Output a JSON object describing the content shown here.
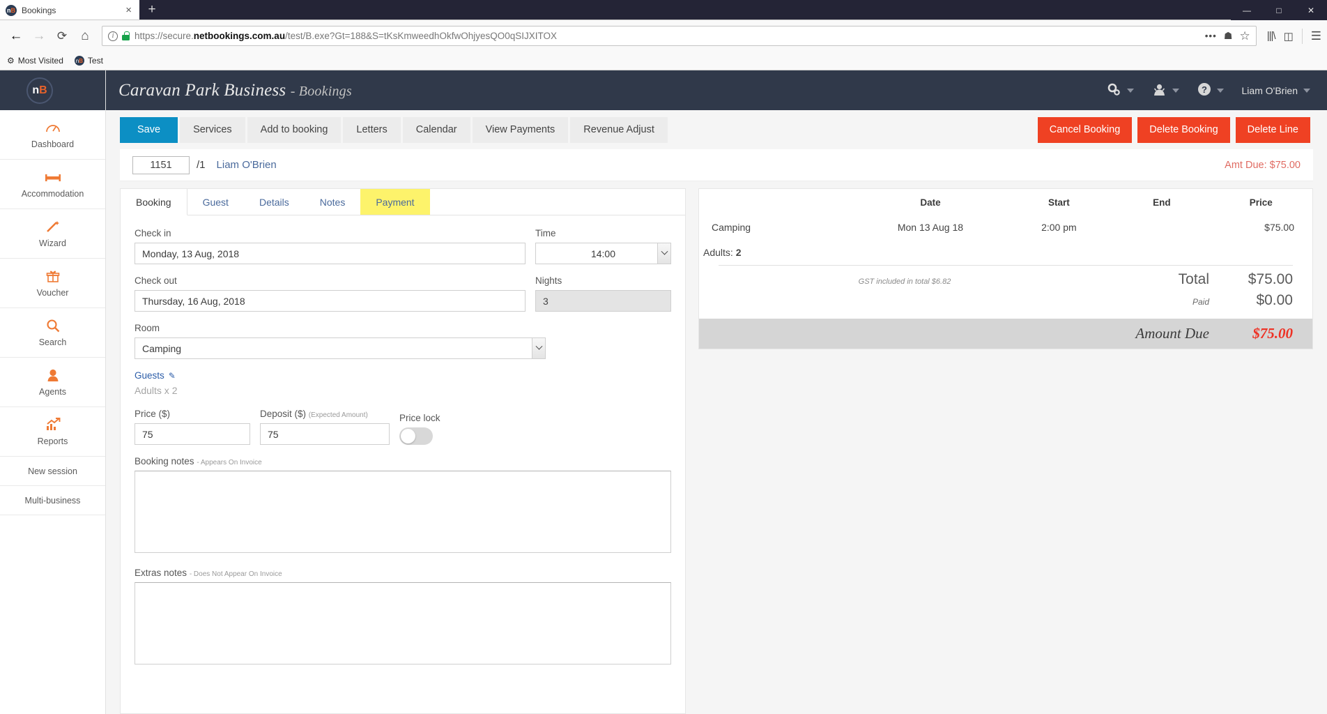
{
  "browser": {
    "tab": {
      "title": "Bookings",
      "favicon": "nb-icon",
      "close_label": "×"
    },
    "new_tab_label": "+",
    "window_controls": {
      "minimize": "—",
      "maximize": "□",
      "close": "✕"
    },
    "nav": {
      "back": "←",
      "forward": "→",
      "reload": "⟳",
      "home": "⌂"
    },
    "url": {
      "scheme": "https://secure.",
      "domain": "netbookings.com.au",
      "path": "/test/B.exe?Gt=188&S=tKsKmweedhOkfwOhjyesQO0qSIJXITOX",
      "full": "https://secure.netbookings.com.au/test/B.exe?Gt=188&S=tKsKmweedhOkfwOhjyesQO0qSIJXITOX",
      "menu_icon": "•••",
      "pocket_icon": "pocket-icon",
      "star_icon": "☆"
    },
    "toolbar_right": {
      "library": "library-icon",
      "sidebar": "sidebar-icon",
      "menu": "☰"
    },
    "bookmarks": [
      {
        "label": "Most Visited",
        "icon": "gear-icon"
      },
      {
        "label": "Test",
        "icon": "nb-icon"
      }
    ]
  },
  "sidebar": {
    "logo": {
      "left": "n",
      "right": "B"
    },
    "items": [
      {
        "label": "Dashboard",
        "icon": "dashboard-icon",
        "glyph": "◔"
      },
      {
        "label": "Accommodation",
        "icon": "bed-icon",
        "glyph": "⌷"
      },
      {
        "label": "Wizard",
        "icon": "wand-icon",
        "glyph": "✦"
      },
      {
        "label": "Voucher",
        "icon": "gift-icon",
        "glyph": "❀"
      },
      {
        "label": "Search",
        "icon": "search-icon",
        "glyph": "⚲"
      },
      {
        "label": "Agents",
        "icon": "agent-icon",
        "glyph": "♟"
      },
      {
        "label": "Reports",
        "icon": "chart-icon",
        "glyph": "↗"
      }
    ],
    "plain_items": [
      {
        "label": "New session"
      },
      {
        "label": "Multi-business"
      }
    ]
  },
  "header": {
    "business": "Caravan Park Business",
    "section": "- Bookings",
    "settings_icon": "gears-icon",
    "user_icon": "user-icon",
    "help_icon": "question-icon",
    "username": "Liam O'Brien"
  },
  "toolbar": {
    "buttons": [
      {
        "label": "Save",
        "style": "primary"
      },
      {
        "label": "Services",
        "style": "default"
      },
      {
        "label": "Add to booking",
        "style": "default"
      },
      {
        "label": "Letters",
        "style": "default"
      },
      {
        "label": "Calendar",
        "style": "default"
      },
      {
        "label": "View Payments",
        "style": "default"
      },
      {
        "label": "Revenue Adjust",
        "style": "default"
      }
    ],
    "danger_buttons": [
      {
        "label": "Cancel Booking"
      },
      {
        "label": "Delete Booking"
      },
      {
        "label": "Delete Line"
      }
    ]
  },
  "booking_id_row": {
    "booking_number": "1151",
    "line_suffix": "/1",
    "guest_name": "Liam O'Brien",
    "amount_due_label": "Amt Due: $75.00"
  },
  "tabs": [
    {
      "label": "Booking",
      "active": true
    },
    {
      "label": "Guest",
      "active": false
    },
    {
      "label": "Details",
      "active": false
    },
    {
      "label": "Notes",
      "active": false
    },
    {
      "label": "Payment",
      "active": false,
      "highlighted": true
    }
  ],
  "form": {
    "check_in_label": "Check in",
    "check_in_value": "Monday, 13 Aug, 2018",
    "time_label": "Time",
    "time_value": "14:00",
    "check_out_label": "Check out",
    "check_out_value": "Thursday, 16 Aug, 2018",
    "nights_label": "Nights",
    "nights_value": "3",
    "room_label": "Room",
    "room_value": "Camping",
    "guests_label": "Guests",
    "guests_edit_icon": "pencil-icon",
    "guests_summary": "Adults x 2",
    "price_label": "Price ($)",
    "price_value": "75",
    "deposit_label": "Deposit ($)",
    "deposit_sublabel": "(Expected Amount)",
    "deposit_value": "75",
    "price_lock_label": "Price lock",
    "price_lock_on": false,
    "booking_notes_label": "Booking notes",
    "booking_notes_sublabel": "- Appears On Invoice",
    "booking_notes_value": "",
    "extras_notes_label": "Extras notes",
    "extras_notes_sublabel": "- Does Not Appear On Invoice",
    "extras_notes_value": ""
  },
  "summary": {
    "columns": [
      "",
      "Date",
      "Start",
      "End",
      "Price"
    ],
    "rows": [
      {
        "item": "Camping",
        "date": "Mon 13 Aug 18",
        "start": "2:00 pm",
        "end": "",
        "price": "$75.00",
        "adults_label": "Adults:",
        "adults_count": "2"
      }
    ],
    "gst_note": "GST included in total $6.82",
    "total_label": "Total",
    "total_value": "$75.00",
    "paid_label": "Paid",
    "paid_value": "$0.00",
    "amount_due_label": "Amount Due",
    "amount_due_value": "$75.00"
  },
  "colors": {
    "brand_dark": "#30394a",
    "accent_orange": "#ef7a34",
    "primary_blue": "#0c8fc4",
    "danger_red": "#ef4123",
    "due_red": "#ee3124",
    "link_blue": "#4a6a9c",
    "highlight_yellow": "#fdf36b"
  }
}
